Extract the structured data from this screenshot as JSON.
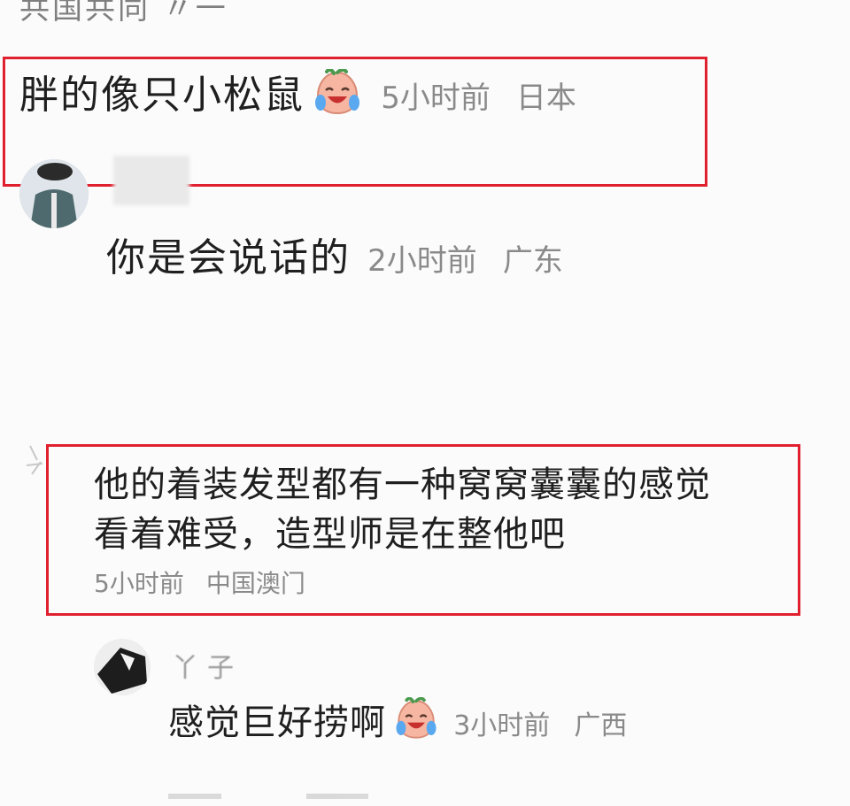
{
  "top_fragment": "共国共同 〃一",
  "comments": [
    {
      "text": "胖的像只小松鼠",
      "emoji": "laugh-cry-emoji",
      "time": "5小时前",
      "location": "日本"
    },
    {
      "text": "你是会说话的",
      "time": "2小时前",
      "location": "广东"
    },
    {
      "line1": "他的着装发型都有一种窝窝囊囊的感觉",
      "line2": "看着难受，造型师是在整他吧",
      "time": "5小时前",
      "location": "中国澳门"
    },
    {
      "username": "丫子",
      "text": "感觉巨好捞啊",
      "emoji": "laugh-cry-emoji",
      "time": "3小时前",
      "location": "广西"
    }
  ],
  "colors": {
    "highlight": "#e0202f",
    "meta_text": "#8a8a8a",
    "main_text": "#1f1f1f"
  }
}
